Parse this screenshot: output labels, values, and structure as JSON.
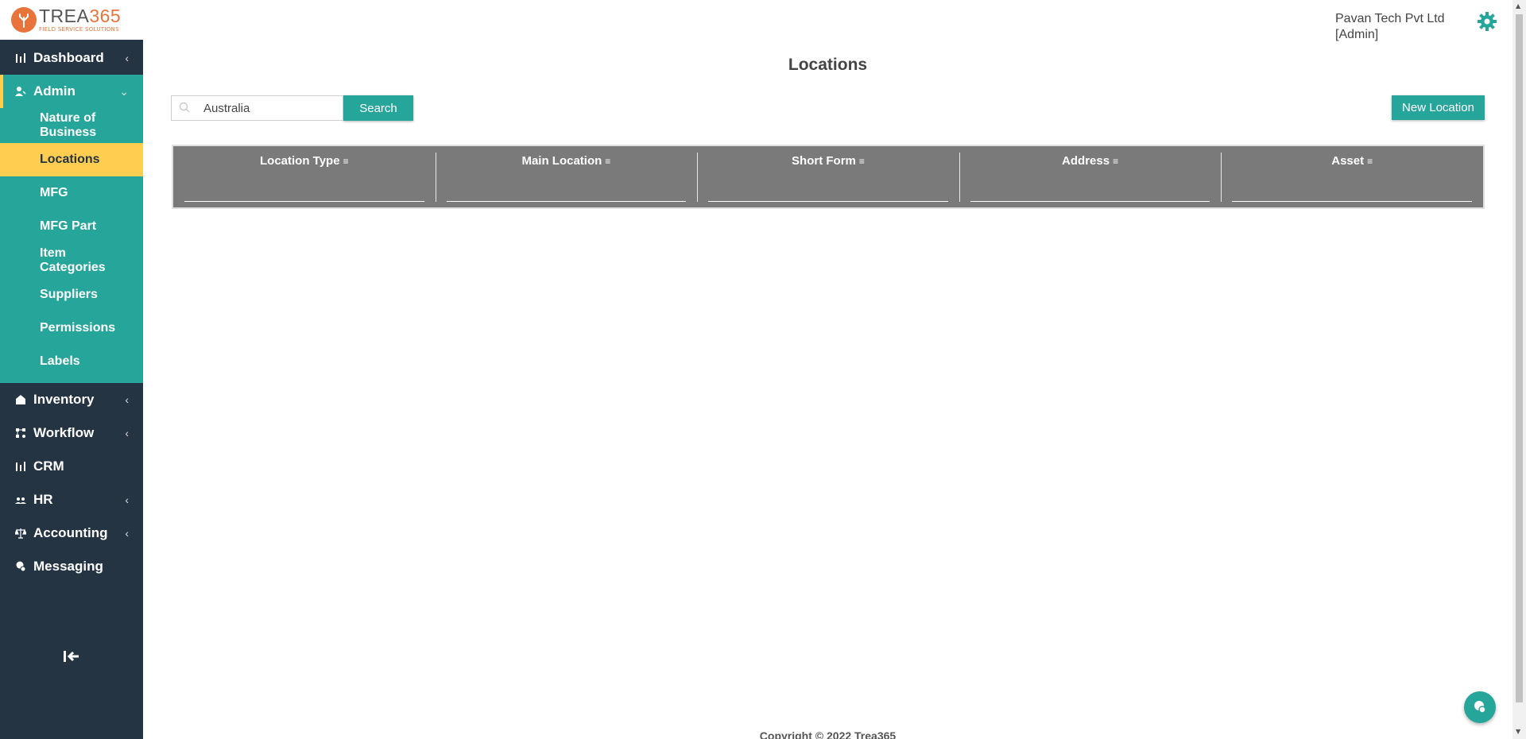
{
  "brand": {
    "name_part1": "TREA",
    "name_part2": "365",
    "tagline": "FIELD SERVICE SOLUTIONS",
    "color_orange": "#e8743b"
  },
  "colors": {
    "sidebar_bg": "#243443",
    "accent_teal": "#26a69a",
    "active_yellow": "#ffcd4f",
    "table_header_bg": "#7a7a7a"
  },
  "user": {
    "company": "Pavan Tech Pvt Ltd",
    "role": "[Admin]"
  },
  "sidebar": {
    "items": [
      {
        "label": "Dashboard",
        "icon": "bar-chart-icon"
      },
      {
        "label": "Admin",
        "icon": "user-icon"
      },
      {
        "label": "Inventory",
        "icon": "home-icon"
      },
      {
        "label": "Workflow",
        "icon": "workflow-icon"
      },
      {
        "label": "CRM",
        "icon": "bar-chart-icon"
      },
      {
        "label": "HR",
        "icon": "people-icon"
      },
      {
        "label": "Accounting",
        "icon": "scale-icon"
      },
      {
        "label": "Messaging",
        "icon": "chat-icon"
      }
    ],
    "admin_sub": [
      {
        "label": "Nature of Business"
      },
      {
        "label": "Locations"
      },
      {
        "label": "MFG"
      },
      {
        "label": "MFG Part"
      },
      {
        "label": "Item Categories"
      },
      {
        "label": "Suppliers"
      },
      {
        "label": "Permissions"
      },
      {
        "label": "Labels"
      }
    ]
  },
  "page": {
    "title": "Locations"
  },
  "search": {
    "value": "Australia",
    "button_label": "Search"
  },
  "toolbar": {
    "new_label": "New Location"
  },
  "table": {
    "columns": [
      "Location Type",
      "Main Location",
      "Short Form",
      "Address",
      "Asset"
    ]
  },
  "footer": {
    "text": "Copyright © 2022 Trea365"
  }
}
